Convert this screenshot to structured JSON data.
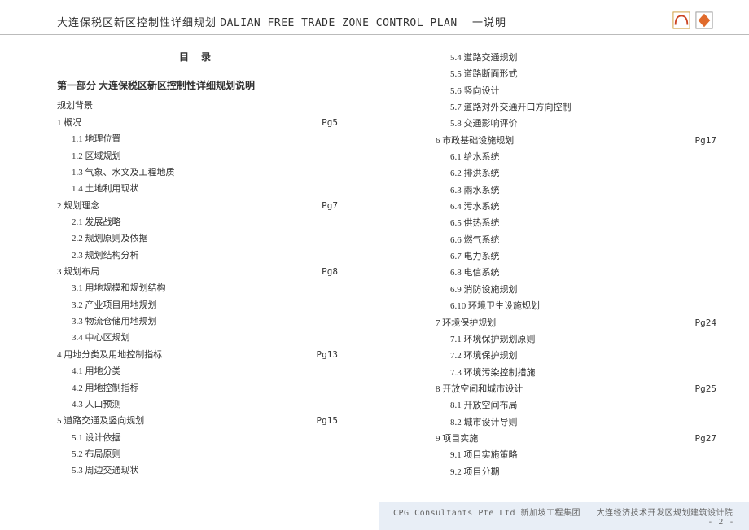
{
  "header": {
    "title_cn": "大连保税区新区控制性详细规划",
    "title_en": "DALIAN FREE TRADE ZONE CONTROL PLAN",
    "title_tag": "一说明"
  },
  "toc_heading": "目  录",
  "part1": {
    "heading": "第一部分  大连保税区新区控制性详细规划说明",
    "background": "规划背景"
  },
  "left": [
    {
      "num": "1",
      "title": "概况",
      "page": "Pg5",
      "subs": [
        {
          "num": "1.1",
          "title": "地理位置"
        },
        {
          "num": "1.2",
          "title": "区域规划"
        },
        {
          "num": "1.3",
          "title": "气象、水文及工程地质"
        },
        {
          "num": "1.4",
          "title": "土地利用现状"
        }
      ]
    },
    {
      "num": "2",
      "title": "规划理念",
      "page": "Pg7",
      "subs": [
        {
          "num": "2.1",
          "title": "发展战略"
        },
        {
          "num": "2.2",
          "title": "规划原则及依据"
        },
        {
          "num": "2.3",
          "title": "规划结构分析"
        }
      ]
    },
    {
      "num": "3",
      "title": "规划布局",
      "page": "Pg8",
      "subs": [
        {
          "num": "3.1",
          "title": "用地规模和规划结构"
        },
        {
          "num": "3.2",
          "title": "产业项目用地规划"
        },
        {
          "num": "3.3",
          "title": "物流仓储用地规划"
        },
        {
          "num": "3.4",
          "title": "中心区规划"
        }
      ]
    },
    {
      "num": "4",
      "title": "用地分类及用地控制指标",
      "page": "Pg13",
      "subs": [
        {
          "num": "4.1",
          "title": "用地分类"
        },
        {
          "num": "4.2",
          "title": "用地控制指标"
        },
        {
          "num": "4.3",
          "title": "人口预测"
        }
      ]
    },
    {
      "num": "5",
      "title": "道路交通及竖向规划",
      "page": "Pg15",
      "subs": [
        {
          "num": "5.1",
          "title": "设计依据"
        },
        {
          "num": "5.2",
          "title": "布局原则"
        },
        {
          "num": "5.3",
          "title": "周边交通现状"
        }
      ]
    }
  ],
  "right_pre": [
    {
      "num": "5.4",
      "title": "道路交通规划"
    },
    {
      "num": "5.5",
      "title": "道路断面形式"
    },
    {
      "num": "5.6",
      "title": "竖向设计"
    },
    {
      "num": "5.7",
      "title": "道路对外交通开口方向控制"
    },
    {
      "num": "5.8",
      "title": "交通影响评价"
    }
  ],
  "right": [
    {
      "num": "6",
      "title": "市政基础设施规划",
      "page": "Pg17",
      "subs": [
        {
          "num": "6.1",
          "title": "给水系统"
        },
        {
          "num": "6.2",
          "title": "排洪系统"
        },
        {
          "num": "6.3",
          "title": "雨水系统"
        },
        {
          "num": "6.4",
          "title": "污水系统"
        },
        {
          "num": "6.5",
          "title": "供热系统"
        },
        {
          "num": "6.6",
          "title": "燃气系统"
        },
        {
          "num": "6.7",
          "title": "电力系统"
        },
        {
          "num": "6.8",
          "title": "电信系统"
        },
        {
          "num": "6.9",
          "title": "消防设施规划"
        },
        {
          "num": "6.10",
          "title": "环境卫生设施规划"
        }
      ]
    },
    {
      "num": "7",
      "title": "环境保护规划",
      "page": "Pg24",
      "subs": [
        {
          "num": "7.1",
          "title": "环境保护规划原则"
        },
        {
          "num": "7.2",
          "title": "环境保护规划"
        },
        {
          "num": "7.3",
          "title": "环境污染控制措施"
        }
      ]
    },
    {
      "num": "8",
      "title": "开放空间和城市设计",
      "page": "Pg25",
      "subs": [
        {
          "num": "8.1",
          "title": "开放空间布局"
        },
        {
          "num": "8.2",
          "title": "城市设计导则"
        }
      ]
    },
    {
      "num": "9",
      "title": "项目实施",
      "page": "Pg27",
      "subs": [
        {
          "num": "9.1",
          "title": "项目实施策略"
        },
        {
          "num": "9.2",
          "title": "项目分期"
        }
      ]
    }
  ],
  "footer": {
    "org1": "CPG Consultants Pte Ltd 新加坡工程集团",
    "org2": "大连经济技术开发区规划建筑设计院",
    "page": "- 2 -"
  }
}
